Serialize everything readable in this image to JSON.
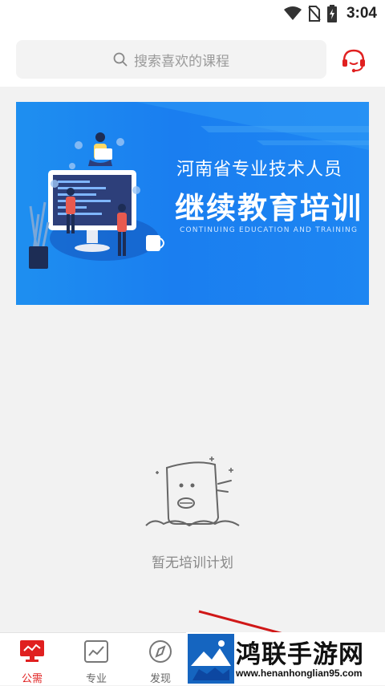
{
  "status_bar": {
    "time": "3:04",
    "icons": [
      "wifi-icon",
      "no-sim-icon",
      "battery-charging-icon"
    ]
  },
  "header": {
    "search_placeholder": "搜索喜欢的课程",
    "search_icon": "search-icon",
    "service_icon": "customer-service-icon"
  },
  "banner": {
    "title_small": "河南省专业技术人员",
    "title_big": "继续教育培训",
    "subtitle": "CONTINUING EDUCATION AND TRAINING"
  },
  "empty_state": {
    "icon": "empty-plan-icon",
    "text": "暂无培训计划"
  },
  "tab_bar": {
    "tabs": [
      {
        "label": "公需",
        "icon": "monitor-icon",
        "active": true
      },
      {
        "label": "专业",
        "icon": "chart-icon",
        "active": false
      },
      {
        "label": "发现",
        "icon": "compass-icon",
        "active": false
      }
    ]
  },
  "watermark": {
    "name": "鸿联手游网",
    "url": "www.henanhonglian95.com"
  },
  "colors": {
    "accent": "#e02020",
    "banner_blue": "#1a7ef0",
    "background": "#f2f2f2"
  }
}
